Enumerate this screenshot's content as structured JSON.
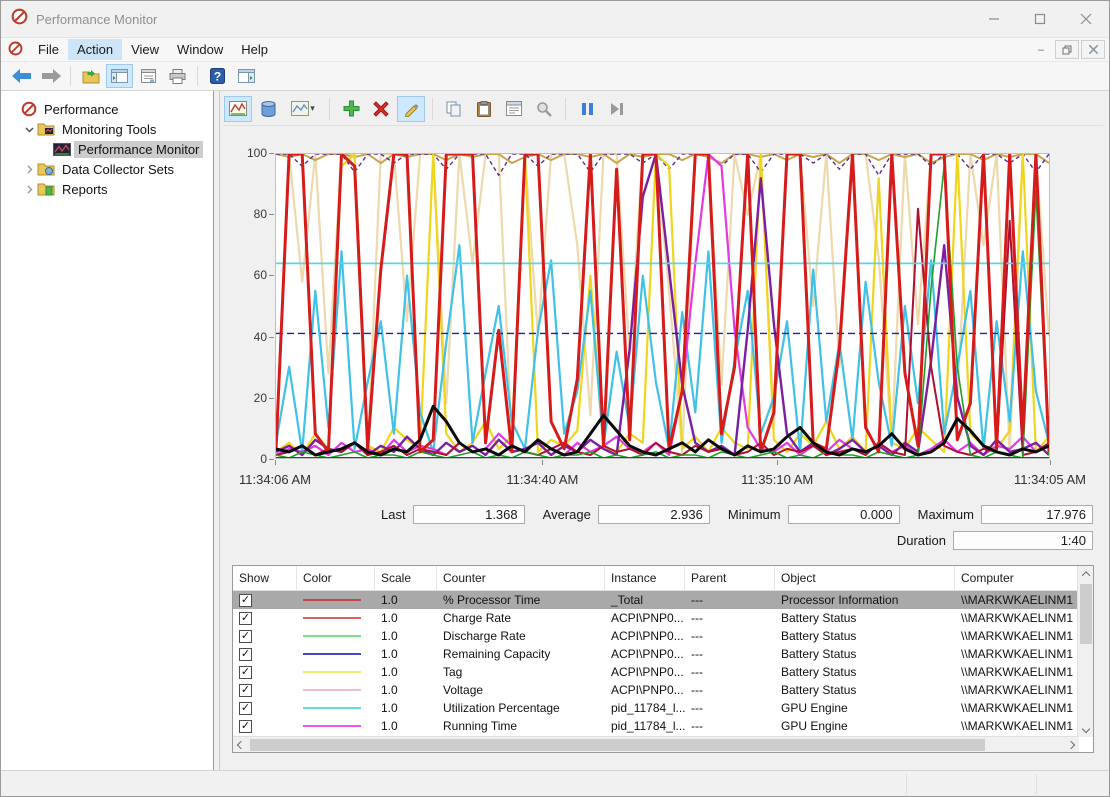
{
  "window": {
    "title": "Performance Monitor"
  },
  "menu": {
    "items": [
      "File",
      "Action",
      "View",
      "Window",
      "Help"
    ],
    "active": "Action"
  },
  "main_toolbar": {
    "icons": [
      "back-icon",
      "forward-icon",
      "export-icon",
      "show-console-tree-icon",
      "properties-icon",
      "print-icon",
      "help-icon",
      "show-action-pane-icon"
    ]
  },
  "sidebar": {
    "items": [
      {
        "label": "Performance",
        "level": 0,
        "icon": "perfmon-icon",
        "expander": "none",
        "selected": false
      },
      {
        "label": "Monitoring Tools",
        "level": 1,
        "icon": "folder-tools-icon",
        "expander": "expanded",
        "selected": false
      },
      {
        "label": "Performance Monitor",
        "level": 2,
        "icon": "perfmon-chart-icon",
        "expander": "none",
        "selected": true
      },
      {
        "label": "Data Collector Sets",
        "level": 1,
        "icon": "folder-collector-icon",
        "expander": "collapsed",
        "selected": false
      },
      {
        "label": "Reports",
        "level": 1,
        "icon": "folder-reports-icon",
        "expander": "collapsed",
        "selected": false
      }
    ]
  },
  "chart_toolbar": {
    "icons": [
      "view-current-activity-icon",
      "view-log-data-icon",
      "change-graph-type-icon",
      "add-counter-icon",
      "delete-counter-icon",
      "highlight-icon",
      "copy-properties-icon",
      "paste-counter-list-icon",
      "properties-dialog-icon",
      "zoom-icon",
      "freeze-display-icon",
      "update-data-icon"
    ],
    "active": [
      "view-current-activity-icon",
      "highlight-icon"
    ],
    "disabled": [
      "zoom-icon",
      "update-data-icon"
    ]
  },
  "stats": {
    "last_label": "Last",
    "last_value": "1.368",
    "average_label": "Average",
    "average_value": "2.936",
    "minimum_label": "Minimum",
    "minimum_value": "0.000",
    "maximum_label": "Maximum",
    "maximum_value": "17.976",
    "duration_label": "Duration",
    "duration_value": "1:40"
  },
  "chart_data": {
    "type": "line",
    "ylim": [
      0,
      100
    ],
    "y_ticks": [
      "100",
      "80",
      "60",
      "40",
      "20",
      "0"
    ],
    "x_ticks": [
      {
        "label": "11:34:06 AM",
        "frac": 0.0
      },
      {
        "label": "11:34:40 AM",
        "frac": 0.345
      },
      {
        "label": "11:35:10 AM",
        "frac": 0.648
      },
      {
        "label": "11:34:05 AM",
        "frac": 1.0
      }
    ],
    "grid": false,
    "legend_position": "table-below",
    "series": [
      {
        "name": "wheat-spikes",
        "color": "#ecd9ac",
        "width": 2.2,
        "values": [
          100,
          100,
          58,
          100,
          28,
          100,
          100,
          2,
          100,
          100,
          45,
          100,
          100,
          18,
          100,
          64,
          100,
          100,
          5,
          100,
          40,
          100,
          100,
          70,
          14,
          100,
          100,
          34,
          100,
          100,
          55,
          2,
          100,
          100,
          24,
          100,
          80,
          100,
          10,
          100,
          100,
          50,
          100,
          30,
          100,
          100,
          66,
          5,
          100,
          44,
          100,
          100,
          20,
          100,
          70,
          100,
          2,
          100,
          100,
          40
        ]
      },
      {
        "name": "darkkhaki-top",
        "color": "#c9a44a",
        "width": 2,
        "values": [
          100,
          99,
          100,
          98,
          100,
          100,
          99,
          100,
          97,
          100,
          99,
          100,
          100,
          98,
          100,
          99,
          100,
          100,
          97,
          99,
          100,
          98,
          100,
          100,
          99,
          100,
          97,
          100,
          99,
          100,
          100,
          98,
          100,
          99,
          97,
          100,
          100,
          99,
          100,
          98,
          100,
          99,
          100,
          97,
          100,
          100,
          98,
          100,
          99,
          100,
          97,
          99,
          100,
          100,
          98,
          100,
          99,
          100,
          100,
          97
        ]
      },
      {
        "name": "purple-dashed-top",
        "color": "#5b2d8e",
        "width": 1.4,
        "dash": "4 3",
        "values": [
          100,
          100,
          96,
          100,
          100,
          100,
          94,
          100,
          100,
          97,
          100,
          100,
          100,
          95,
          100,
          100,
          100,
          93,
          100,
          100,
          96,
          100,
          100,
          100,
          94,
          100,
          100,
          100,
          97,
          100,
          95,
          100,
          100,
          100,
          96,
          100,
          100,
          94,
          100,
          100,
          100,
          97,
          100,
          95,
          100,
          100,
          93,
          100,
          100,
          100,
          96,
          100,
          100,
          95,
          100,
          100,
          97,
          100,
          94,
          100
        ]
      },
      {
        "name": "yellow-spikes",
        "color": "#f0d51c",
        "width": 2.2,
        "values": [
          2,
          5,
          1,
          8,
          3,
          96,
          100,
          4,
          2,
          10,
          6,
          3,
          100,
          8,
          2,
          5,
          12,
          3,
          7,
          100,
          2,
          6,
          4,
          9,
          60,
          3,
          2,
          8,
          5,
          100,
          96,
          3,
          7,
          2,
          10,
          5,
          3,
          100,
          6,
          2,
          8,
          4,
          12,
          3,
          7,
          2,
          92,
          5,
          3,
          10,
          6,
          2,
          100,
          8,
          4,
          3,
          9,
          100,
          2,
          7
        ]
      },
      {
        "name": "cyan-spikes",
        "color": "#3fc1e8",
        "width": 2.2,
        "values": [
          5,
          30,
          2,
          55,
          10,
          68,
          3,
          25,
          45,
          8,
          60,
          15,
          2,
          38,
          70,
          5,
          28,
          50,
          12,
          3,
          42,
          65,
          8,
          22,
          55,
          4,
          35,
          10,
          60,
          25,
          3,
          48,
          15,
          68,
          5,
          32,
          55,
          8,
          20,
          45,
          2,
          62,
          12,
          38,
          6,
          58,
          25,
          4,
          50,
          18,
          65,
          8,
          30,
          55,
          3,
          45,
          12,
          68,
          22,
          5
        ]
      },
      {
        "name": "magenta-spikes",
        "color": "#e23ae2",
        "width": 2.2,
        "values": [
          1,
          3,
          2,
          4,
          1,
          5,
          2,
          3,
          1,
          6,
          2,
          4,
          3,
          1,
          5,
          2,
          3,
          8,
          4,
          2,
          6,
          3,
          1,
          5,
          2,
          4,
          7,
          3,
          2,
          5,
          1,
          22,
          64,
          100,
          96,
          42,
          10,
          3,
          2,
          5,
          1,
          4,
          2,
          6,
          3,
          1,
          5,
          2,
          4,
          1,
          3,
          6,
          2,
          5,
          1,
          4,
          3,
          7,
          2,
          4
        ]
      },
      {
        "name": "purple-spikes",
        "color": "#7a1fa2",
        "width": 2.4,
        "values": [
          2,
          4,
          1,
          6,
          3,
          2,
          5,
          1,
          4,
          2,
          7,
          3,
          1,
          5,
          2,
          4,
          1,
          6,
          2,
          3,
          5,
          1,
          4,
          2,
          6,
          3,
          1,
          36,
          86,
          100,
          62,
          24,
          5,
          2,
          4,
          1,
          42,
          92,
          44,
          8,
          2,
          5,
          1,
          3,
          6,
          2,
          4,
          1,
          5,
          2,
          32,
          70,
          20,
          4,
          1,
          6,
          2,
          3,
          5,
          1
        ]
      },
      {
        "name": "darkred-spikes",
        "color": "#b01030",
        "width": 2,
        "values": [
          1,
          2,
          4,
          1,
          3,
          2,
          5,
          1,
          2,
          4,
          1,
          3,
          2,
          1,
          5,
          2,
          3,
          1,
          4,
          2,
          1,
          3,
          5,
          2,
          1,
          4,
          2,
          3,
          1,
          5,
          2,
          1,
          4,
          2,
          3,
          1,
          2,
          5,
          1,
          3,
          2,
          4,
          1,
          2,
          3,
          1,
          5,
          2,
          1,
          82,
          30,
          4,
          2,
          1,
          3,
          2,
          78,
          1,
          2,
          5
        ]
      },
      {
        "name": "green-spikes",
        "color": "#1ea029",
        "width": 1.6,
        "values": [
          1,
          0,
          2,
          1,
          0,
          1,
          2,
          0,
          1,
          1,
          0,
          2,
          1,
          0,
          1,
          2,
          0,
          1,
          0,
          2,
          1,
          0,
          1,
          1,
          2,
          0,
          1,
          0,
          1,
          2,
          0,
          1,
          1,
          0,
          2,
          1,
          0,
          1,
          2,
          0,
          1,
          0,
          2,
          1,
          1,
          0,
          2,
          1,
          0,
          1,
          56,
          96,
          30,
          1,
          0,
          2,
          1,
          0,
          88,
          1
        ]
      },
      {
        "name": "maroon-baseline",
        "color": "#8b2020",
        "width": 2,
        "const": 0
      },
      {
        "name": "cyan-constant",
        "color": "#59d4e8",
        "width": 1.8,
        "const": 64
      },
      {
        "name": "navy-constant",
        "color": "#1f1fa8",
        "width": 1.4,
        "dash": "7 4",
        "const": 41
      },
      {
        "name": "red-processor-spikes",
        "color": "#d61b1b",
        "width": 3,
        "values": [
          3,
          100,
          100,
          8,
          2,
          100,
          96,
          3,
          62,
          100,
          100,
          2,
          6,
          100,
          100,
          100,
          5,
          42,
          2,
          100,
          100,
          12,
          3,
          26,
          100,
          4,
          95,
          6,
          100,
          100,
          3,
          22,
          100,
          100,
          8,
          30,
          100,
          2,
          15,
          100,
          100,
          5,
          3,
          36,
          100,
          10,
          2,
          100,
          28,
          4,
          100,
          100,
          6,
          18,
          100,
          3,
          100,
          8,
          100,
          2
        ]
      },
      {
        "name": "black-highlighted-processor-time",
        "color": "#0a0a0a",
        "width": 3,
        "values": [
          3,
          2,
          4,
          1,
          2,
          3,
          5,
          2,
          1,
          3,
          2,
          6,
          17,
          12,
          5,
          2,
          3,
          1,
          4,
          2,
          6,
          3,
          1,
          2,
          8,
          14,
          9,
          4,
          2,
          1,
          3,
          5,
          2,
          6,
          3,
          1,
          4,
          2,
          3,
          7,
          10,
          5,
          2,
          1,
          3,
          2,
          4,
          8,
          3,
          1,
          2,
          5,
          13,
          9,
          4,
          2,
          1,
          3,
          2,
          4
        ]
      }
    ]
  },
  "table": {
    "columns": [
      "Show",
      "Color",
      "Scale",
      "Counter",
      "Instance",
      "Parent",
      "Object",
      "Computer"
    ],
    "rows": [
      {
        "show": true,
        "color": "#c04a4a",
        "scale": "1.0",
        "counter": "% Processor Time",
        "instance": "_Total",
        "parent": "---",
        "object": "Processor Information",
        "computer": "\\\\MARKWKAELINM1",
        "selected": true
      },
      {
        "show": true,
        "color": "#e06060",
        "scale": "1.0",
        "counter": "Charge Rate",
        "instance": "ACPI\\PNP0...",
        "parent": "---",
        "object": "Battery Status",
        "computer": "\\\\MARKWKAELINM1",
        "selected": false
      },
      {
        "show": true,
        "color": "#7ce08a",
        "scale": "1.0",
        "counter": "Discharge Rate",
        "instance": "ACPI\\PNP0...",
        "parent": "---",
        "object": "Battery Status",
        "computer": "\\\\MARKWKAELINM1",
        "selected": false
      },
      {
        "show": true,
        "color": "#4747c7",
        "scale": "1.0",
        "counter": "Remaining Capacity",
        "instance": "ACPI\\PNP0...",
        "parent": "---",
        "object": "Battery Status",
        "computer": "\\\\MARKWKAELINM1",
        "selected": false
      },
      {
        "show": true,
        "color": "#eded72",
        "scale": "1.0",
        "counter": "Tag",
        "instance": "ACPI\\PNP0...",
        "parent": "---",
        "object": "Battery Status",
        "computer": "\\\\MARKWKAELINM1",
        "selected": false
      },
      {
        "show": true,
        "color": "#edbccd",
        "scale": "1.0",
        "counter": "Voltage",
        "instance": "ACPI\\PNP0...",
        "parent": "---",
        "object": "Battery Status",
        "computer": "\\\\MARKWKAELINM1",
        "selected": false
      },
      {
        "show": true,
        "color": "#5fdede",
        "scale": "1.0",
        "counter": "Utilization Percentage",
        "instance": "pid_11784_l...",
        "parent": "---",
        "object": "GPU Engine",
        "computer": "\\\\MARKWKAELINM1",
        "selected": false
      },
      {
        "show": true,
        "color": "#ee55ee",
        "scale": "1.0",
        "counter": "Running Time",
        "instance": "pid_11784_l...",
        "parent": "---",
        "object": "GPU Engine",
        "computer": "\\\\MARKWKAELINM1",
        "selected": false
      }
    ]
  }
}
